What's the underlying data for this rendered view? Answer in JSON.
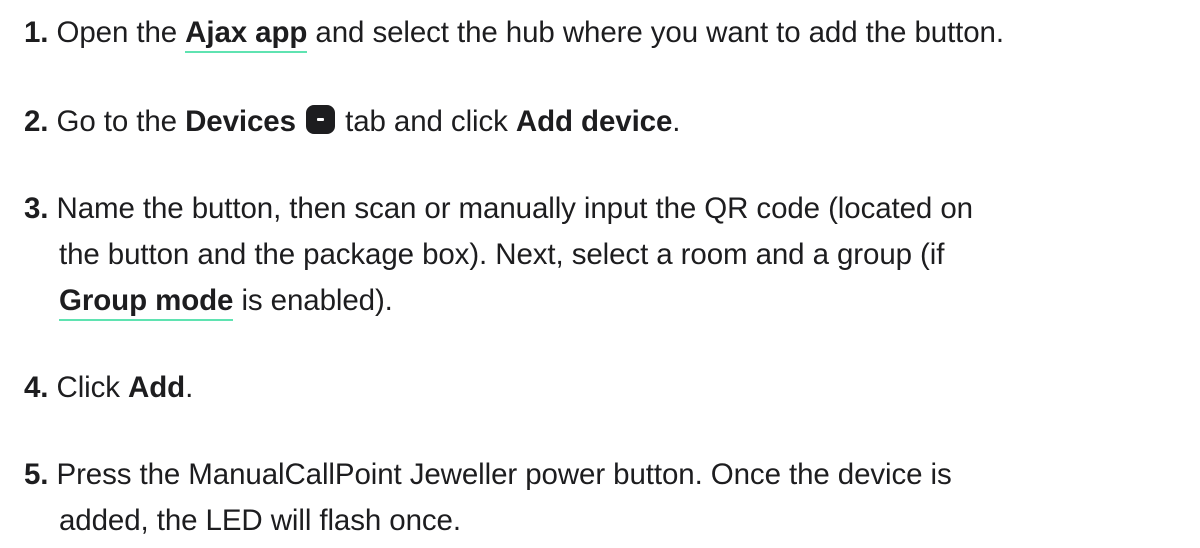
{
  "steps": [
    {
      "num": "1.",
      "t1": " Open the ",
      "link": "Ajax app",
      "t2": " and select the hub where you want to add the button."
    },
    {
      "num": "2.",
      "t1": " Go to the ",
      "bold1": "Devices",
      "icon": "devices-icon",
      "t2": " tab and click ",
      "bold2": "Add device",
      "t3": "."
    },
    {
      "num": "3.",
      "t1": " Name the button, then scan or manually input the QR code (located on",
      "line2": "the button and the package box). Next, select a room and a group (if",
      "link": "Group mode",
      "t3": " is enabled)."
    },
    {
      "num": "4.",
      "t1": " Click ",
      "bold1": "Add",
      "t2": "."
    },
    {
      "num": "5.",
      "t1": " Press the ManualCallPoint Jeweller power button. Once the device is",
      "line2": "added, the LED will flash once."
    }
  ],
  "colors": {
    "text": "#1d1d1f",
    "link_underline": "#5fe3b1",
    "background": "#ffffff"
  }
}
